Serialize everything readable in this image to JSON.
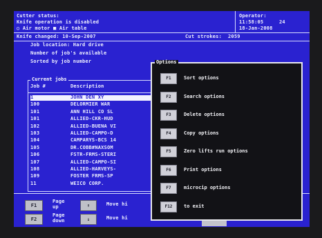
{
  "status": {
    "cutter_status": "Cutter status:",
    "knife_operation": "Knife operation is disabled",
    "air_motor": "Air motor",
    "air_table": "Air table",
    "knife_changed": "Knife changed: 10-Sep-2007",
    "cut_strokes_label": "Cut strokes:",
    "cut_strokes_value": "2059"
  },
  "operator": {
    "label": "Operator:",
    "time": "11:58:05",
    "id": "24",
    "date": "18-Jan-2008"
  },
  "jobs": {
    "location": "Job location: Hard drive",
    "available": "Number of job's available",
    "sorted": "Sorted by job number",
    "box_title": "Current jobs",
    "col_job": "Job #",
    "col_desc": "Description",
    "rows": [
      {
        "num": "1",
        "desc": "JOHN DEN XY"
      },
      {
        "num": "100",
        "desc": "DELORMIER WAR"
      },
      {
        "num": "101",
        "desc": "ANN HILL CO SL"
      },
      {
        "num": "101",
        "desc": "ALLIED-CKR-HUD"
      },
      {
        "num": "102",
        "desc": "ALLIED-BUENA VI"
      },
      {
        "num": "103",
        "desc": "ALLIED-CAMPO-D"
      },
      {
        "num": "104",
        "desc": "CAMPARYS-BCS 14"
      },
      {
        "num": "105",
        "desc": "DR.COBB#NAXSOM"
      },
      {
        "num": "106",
        "desc": "FSTR-FRMS-STERI"
      },
      {
        "num": "107",
        "desc": "ALLIED-CAMPO-SI"
      },
      {
        "num": "108",
        "desc": "ALLIED-HARVEYS-"
      },
      {
        "num": "109",
        "desc": "FOSTER FRMS-SP"
      },
      {
        "num": "11",
        "desc": "WEICO CORP."
      }
    ]
  },
  "bottom": {
    "f1": "F1",
    "page_up": "Page up",
    "up_arrow": "↑",
    "move_up": "Move hi",
    "f2": "F2",
    "page_down": "Page down",
    "down_arrow": "↓",
    "move_down": "Move hi"
  },
  "options": {
    "title": "Options",
    "items": [
      {
        "key": "F1",
        "label": "Sort options"
      },
      {
        "key": "F2",
        "label": "Search options"
      },
      {
        "key": "F3",
        "label": "Delete options"
      },
      {
        "key": "F4",
        "label": "Copy options"
      },
      {
        "key": "F5",
        "label": "Zero lifts run options"
      },
      {
        "key": "F6",
        "label": "Print options"
      },
      {
        "key": "F7",
        "label": "microcip options"
      },
      {
        "key": "F12",
        "label": "to exit"
      }
    ]
  },
  "colors": {
    "screen_bg": "#2a22d0",
    "text": "#eef0ff",
    "dialog_bg": "#121216",
    "key_face": "#d0d0d8"
  }
}
